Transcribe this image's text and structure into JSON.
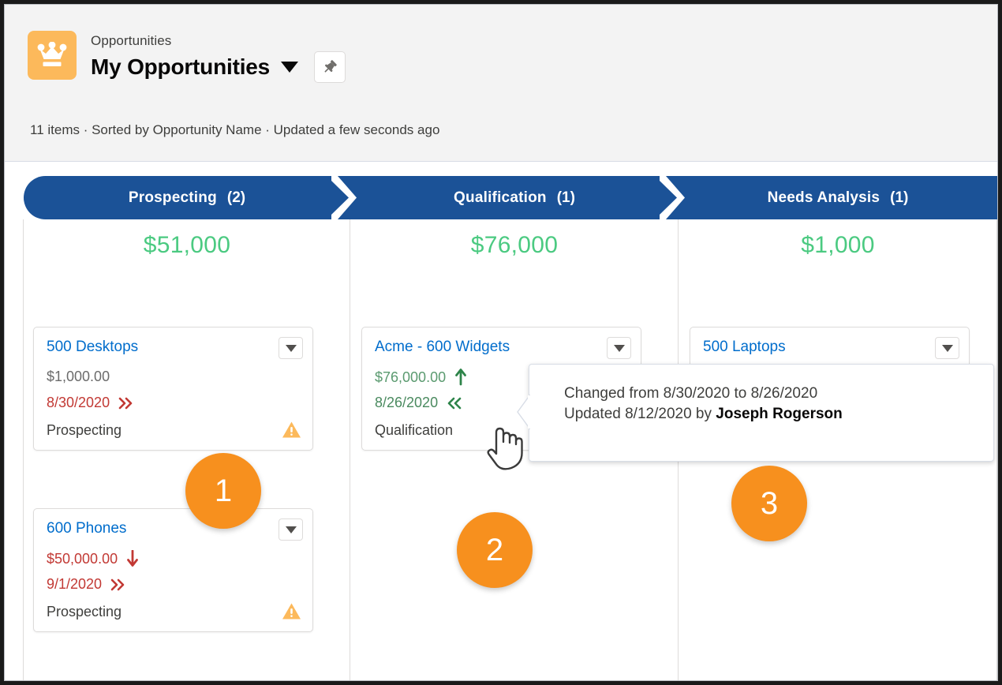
{
  "header": {
    "object_icon": "crown-icon",
    "object_name": "Opportunities",
    "list_title": "My Opportunities",
    "list_title_caret": "chevron-down-icon",
    "pin_icon": "pin-icon",
    "meta": "11 items · Sorted by Opportunity Name · Updated a few seconds ago"
  },
  "colors": {
    "stage_blue": "#1b5297",
    "sum_green": "#4bca81",
    "link_blue": "#006dcc",
    "badge_orange": "#f7901e",
    "warning_orange": "#fcb95b",
    "down_red": "#c23934",
    "up_green": "#2e844a",
    "crown_tile": "#fcb95b"
  },
  "columns": [
    {
      "stage": "Prospecting",
      "count": "(2)",
      "sum": "$51,000",
      "cards": [
        {
          "title": "500 Desktops",
          "amount": "$1,000.00",
          "amount_class": "amt-grey",
          "amount_indicator": "none",
          "date": "8/30/2020",
          "date_class": "date-red",
          "date_indicator": "double-chevron-right-icon",
          "stage": "Prospecting",
          "warning": "warning-triangle-icon",
          "menu": "chevron-down-icon"
        },
        {
          "title": "600 Phones",
          "amount": "$50,000.00",
          "amount_class": "amt-red",
          "amount_indicator": "arrow-down-icon",
          "date": "9/1/2020",
          "date_class": "date-red",
          "date_indicator": "double-chevron-right-icon",
          "stage": "Prospecting",
          "warning": "warning-triangle-icon",
          "menu": "chevron-down-icon"
        }
      ]
    },
    {
      "stage": "Qualification",
      "count": "(1)",
      "sum": "$76,000",
      "cards": [
        {
          "title": "Acme - 600 Widgets",
          "amount": "$76,000.00",
          "amount_class": "amt-green",
          "amount_indicator": "arrow-up-icon",
          "date": "8/26/2020",
          "date_class": "date-green",
          "date_indicator": "double-chevron-left-icon",
          "stage": "Qualification",
          "warning": "none",
          "menu": "chevron-down-icon"
        }
      ]
    },
    {
      "stage": "Needs Analysis",
      "count": "(1)",
      "sum": "$1,000",
      "cards": [
        {
          "title": "500 Laptops",
          "amount": "",
          "amount_class": "amt-grey",
          "amount_indicator": "none",
          "date": "",
          "date_class": "date-red",
          "date_indicator": "none",
          "stage": "",
          "warning": "none",
          "menu": "chevron-down-icon"
        }
      ]
    }
  ],
  "tooltip": {
    "line1": "Changed from 8/30/2020 to 8/26/2020",
    "line2_prefix": "Updated 8/12/2020 by ",
    "line2_user": "Joseph Rogerson"
  },
  "cursor": "pointing-hand-cursor",
  "annotations": [
    {
      "label": "1"
    },
    {
      "label": "2"
    },
    {
      "label": "3"
    }
  ]
}
